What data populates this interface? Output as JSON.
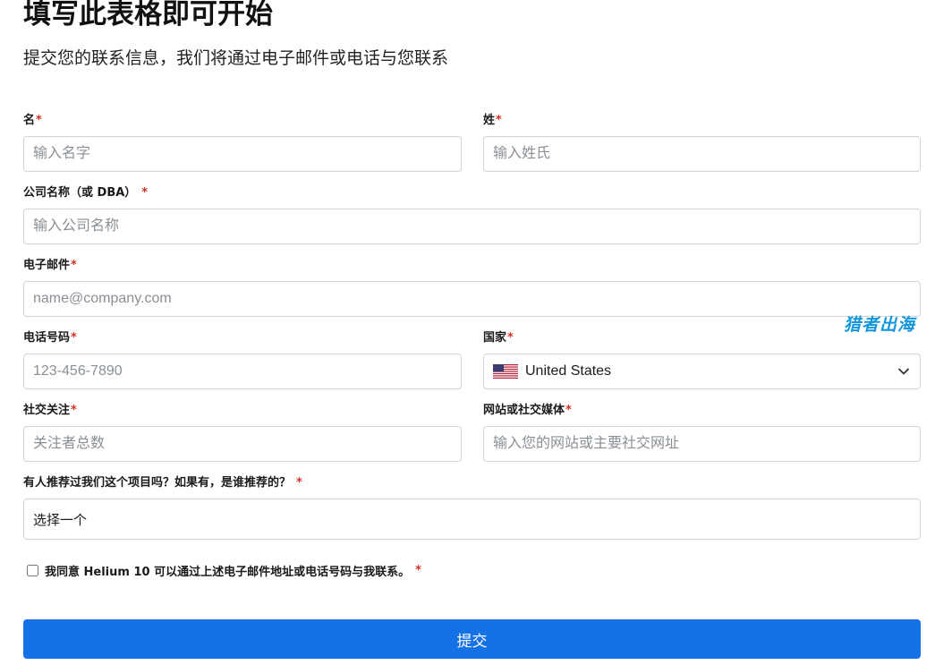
{
  "header": {
    "title": "填写此表格即可开始",
    "subtitle": "提交您的联系信息，我们将通过电子邮件或电话与您联系"
  },
  "fields": {
    "first_name": {
      "label": "名",
      "required_mark": "*",
      "placeholder": "输入名字"
    },
    "last_name": {
      "label": "姓",
      "required_mark": "*",
      "placeholder": "输入姓氏"
    },
    "company": {
      "label": "公司名称（或 DBA）",
      "required_mark": "*",
      "placeholder": "输入公司名称"
    },
    "email": {
      "label": "电子邮件",
      "required_mark": "*",
      "placeholder": "name@company.com"
    },
    "phone": {
      "label": "电话号码",
      "required_mark": "*",
      "placeholder": "123-456-7890"
    },
    "country": {
      "label": "国家",
      "required_mark": "*",
      "value": "United States",
      "flag_icon": "us-flag-icon"
    },
    "social_followers": {
      "label": "社交关注",
      "required_mark": "*",
      "placeholder": "关注者总数"
    },
    "website": {
      "label": "网站或社交媒体",
      "required_mark": "*",
      "placeholder": "输入您的网站或主要社交网址"
    },
    "referral": {
      "label": "有人推荐过我们这个项目吗？如果有，是谁推荐的？",
      "required_mark": "*",
      "value": "选择一个"
    }
  },
  "consent": {
    "text": "我同意 Helium 10 可以通过上述电子邮件地址或电话号码与我联系。",
    "required_mark": "*",
    "checked": false
  },
  "submit": {
    "label": "提交"
  },
  "watermark": {
    "text": "猎者出海"
  },
  "colors": {
    "primary": "#1471e6",
    "required": "#d93025",
    "border": "#cfd4da",
    "watermark": "#1296db"
  }
}
